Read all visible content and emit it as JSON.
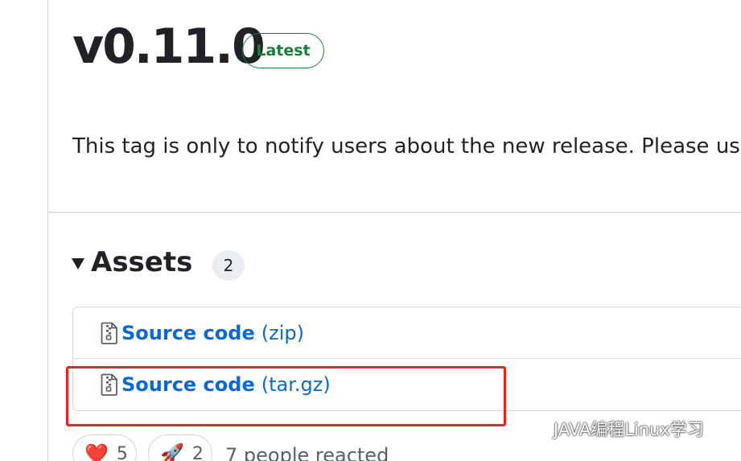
{
  "release": {
    "title": "v0.11.0",
    "badge": "Latest",
    "body": "This tag is only to notify users about the new release. Please us"
  },
  "assets": {
    "heading": "Assets",
    "count": "2",
    "items": [
      {
        "name": "Source code",
        "ext": "(zip)",
        "icon": "file-zip-icon"
      },
      {
        "name": "Source code",
        "ext": "(tar.gz)",
        "icon": "file-zip-icon"
      }
    ]
  },
  "reactions": {
    "items": [
      {
        "emoji": "❤️",
        "count": "5",
        "icon": "heart-icon"
      },
      {
        "emoji": "🚀",
        "count": "2",
        "icon": "rocket-icon"
      }
    ],
    "summary": "7 people reacted"
  },
  "watermark": {
    "text": "JAVA编程Linux学习",
    "icon": "wechat-icon"
  },
  "colors": {
    "link": "#0969da",
    "badge_green": "#1a7f37",
    "highlight_red": "#ff1b1b",
    "border": "#d0d7de"
  }
}
